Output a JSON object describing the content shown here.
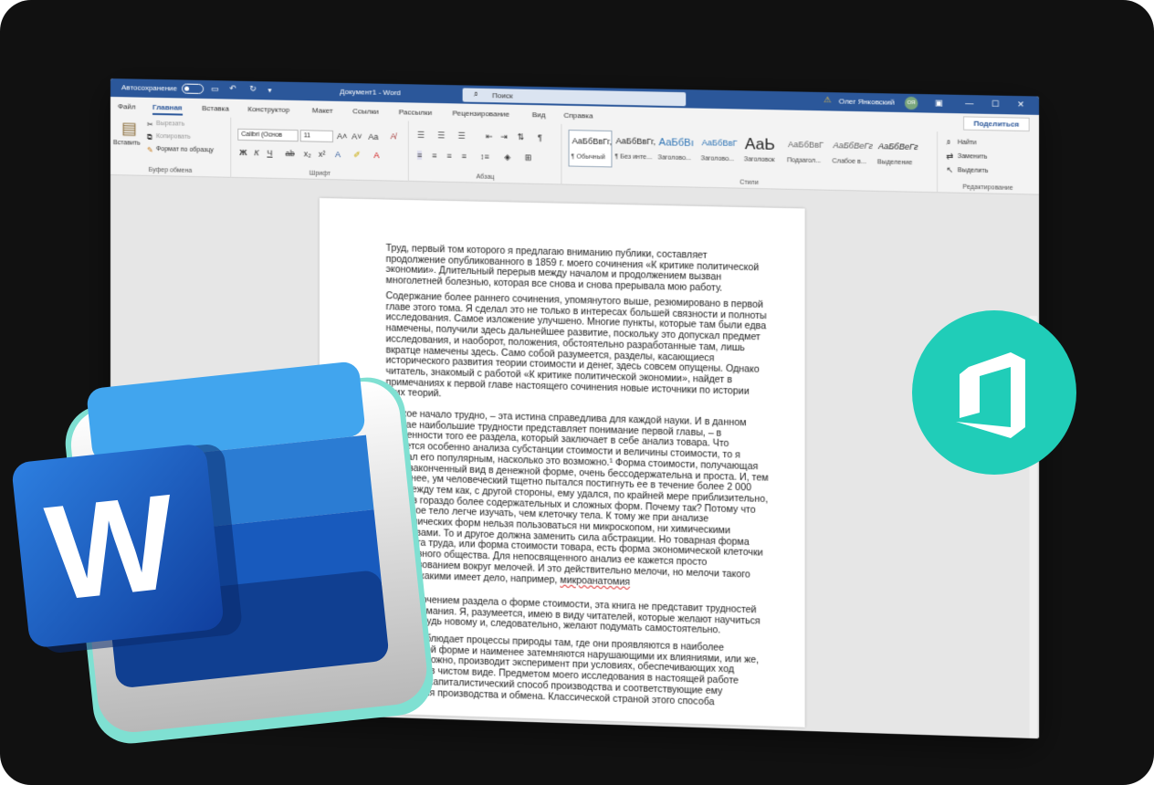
{
  "titlebar": {
    "autosave": "Автосохранение",
    "title": "Документ1 - Word",
    "search_placeholder": "Поиск",
    "user": "Олег Янковский",
    "user_initials": "ОЯ"
  },
  "tabs": [
    "Файл",
    "Главная",
    "Вставка",
    "Конструктор",
    "Макет",
    "Ссылки",
    "Рассылки",
    "Рецензирование",
    "Вид",
    "Справка"
  ],
  "share_label": "Поделиться",
  "ribbon": {
    "clipboard": {
      "paste": "Вставить",
      "cut": "Вырезать",
      "copy": "Копировать",
      "format_painter": "Формат по образцу",
      "label": "Буфер обмена"
    },
    "font": {
      "family": "Calibri (Основ",
      "size": "11",
      "label": "Шрифт",
      "bold": "Ж",
      "italic": "К",
      "underline": "Ч"
    },
    "paragraph": {
      "label": "Абзац"
    },
    "styles": {
      "label": "Стили",
      "items": [
        {
          "preview": "АаБбВвГг,",
          "name": "¶ Обычный"
        },
        {
          "preview": "АаБбВвГг,",
          "name": "¶ Без инте..."
        },
        {
          "preview": "АаБбВı",
          "name": "Заголово..."
        },
        {
          "preview": "АаБбВвГ",
          "name": "Заголово..."
        },
        {
          "preview": "АаЬ",
          "name": "Заголовок"
        },
        {
          "preview": "АаБбВвГ",
          "name": "Подзагол..."
        },
        {
          "preview": "АаБбВеГг",
          "name": "Слабое в..."
        },
        {
          "preview": "АаБбВеГг",
          "name": "Выделение"
        }
      ]
    },
    "editing": {
      "find": "Найти",
      "replace": "Заменить",
      "select": "Выделить",
      "label": "Редактирование"
    }
  },
  "document": {
    "p1": "Труд, первый том которого я предлагаю вниманию публики, составляет продолжение опубликованного в 1859 г. моего сочинения «К критике политической экономии». Длительный перерыв между началом и продолжением вызван многолетней болезнью, которая все снова и снова прерывала мою работу.",
    "p2": "Содержание более раннего сочинения, упомянутого выше, резюмировано в первой главе этого тома. Я сделал это не только в интересах большей связности и полноты исследования. Самое изложение улучшено. Многие пункты, которые там были едва намечены, получили здесь дальнейшее развитие, поскольку это допускал предмет исследования, и наоборот, положения, обстоятельно разработанные там, лишь вкратце намечены здесь. Само собой разумеется, разделы, касающиеся исторического развития теории стоимости и денег, здесь совсем опущены. Однако читатель, знакомый с работой «К критике политической экономии», найдет в примечаниях к первой главе настоящего сочинения новые источники по истории этих теорий.",
    "p3": "Всякое начало трудно, – эта истина справедлива для каждой науки. И в данном случае наибольшие трудности представляет понимание первой главы, – в особенности того ее раздела, который заключает в себе анализ товара. Что касается особенно анализа субстанции стоимости и величины стоимости, то я сделал его популярным, насколько это возможно.¹ Форма стоимости, получающая свой законченный вид в денежной форме, очень бессодержательна и проста. И, тем не менее, ум человеческий тщетно пытался постигнуть ее в течение более 2 000 лет, между тем как, с другой стороны, ему удался, по крайней мере приблизительно, анализ гораздо более содержательных и сложных форм. Почему так? Потому что развитое тело легче изучать, чем клеточку тела. К тому же при анализе экономических форм нельзя пользоваться ни микроскопом, ни химическими реактивами. То и другое должна заменить сила абстракции. Но товарная форма продукта труда, или форма стоимости товара, есть форма экономической клеточки буржуазного общества. Для непосвященного анализ ее кажется просто мудрствованием вокруг мелочей. И это действительно мелочи, но мелочи такого рода, с какими имеет дело, например,",
    "p3_spell": "микроанатомия",
    "p4": "За исключением раздела о форме стоимости, эта книга не представит трудностей для понимания. Я, разумеется, имею в виду читателей, которые желают научиться чему-нибудь новому и, следовательно, желают подумать самостоятельно.",
    "p5": "Физик наблюдает процессы природы там, где они проявляются в наиболее отчетливой форме и наименее затемняются нарушающими их влияниями, или же, если возможно, производит эксперимент при условиях, обеспечивающих ход процесса в чистом виде. Предметом моего исследования в настоящей работе является капиталистический способ производства и соответствующие ему отношения производства и обмена. Классической страной этого способа"
  },
  "colors": {
    "word_blue": "#2b579a",
    "office_teal": "#20cdb8",
    "logo_letter": "W"
  }
}
